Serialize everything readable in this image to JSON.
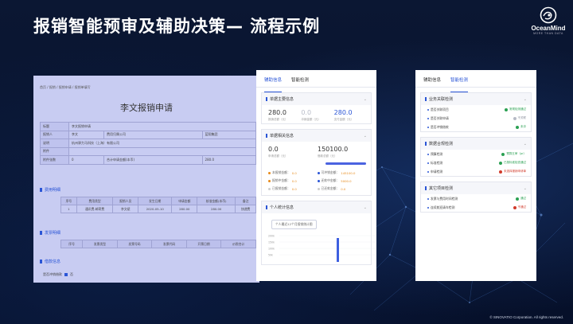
{
  "slide": {
    "title": "报销智能预审及辅助决策— 流程示例",
    "logo_name": "OceanMind",
    "logo_tagline": "MORE THAN DATA",
    "copyright": "© SINOVATIO Corporation. All rights reserved."
  },
  "form": {
    "breadcrumb": "首页  /  报销  /  报销申请  /  报销单填写",
    "title": "李文报销申请",
    "fields": [
      {
        "label": "标题",
        "value": "李文报销申请",
        "label2": "",
        "value2": ""
      },
      {
        "label": "报销人",
        "value": "李文",
        "label2": "费用归属公司",
        "value2": "蓝翔集团"
      },
      {
        "label": "说明",
        "value": "杭州驿力马科技（上海）有限公司",
        "label2": "",
        "value2": ""
      },
      {
        "label": "附件",
        "value": "",
        "label2": "",
        "value2": ""
      },
      {
        "label": "附件张数",
        "value": "0",
        "label2": "合计申请金额(本币)",
        "value2": "280.0"
      }
    ],
    "expense_section": "费用明细",
    "expense_headers": [
      "序号",
      "费用类型",
      "报销人员",
      "发生日期",
      "申请金额",
      "核准金额(本币)",
      "备注"
    ],
    "expense_rows": [
      [
        "1",
        "通讯费-邮寄费",
        "李文斌",
        "2020-05-10",
        "280.00",
        "280.00",
        "快递费"
      ]
    ],
    "invoice_section": "发票明细",
    "invoice_headers": [
      "序号",
      "发票类型",
      "发票号码",
      "发票代码",
      "开票日期",
      "价税合计"
    ],
    "loan_section": "借款信息",
    "loan_check_label": "是否冲销借款",
    "loan_check_value": "否"
  },
  "mid": {
    "tabs": [
      "辅助信息",
      "智能检测"
    ],
    "summary": {
      "title": "单据主要信息",
      "items": [
        {
          "value": "280.0",
          "label": "报销总额（元）"
        },
        {
          "value": "0.0",
          "label": "冲销金额（元）"
        },
        {
          "value": "280.0",
          "label": "支付金额（元）"
        }
      ]
    },
    "budget": {
      "title": "单据相关信息",
      "left": {
        "value": "0.0",
        "label": "申请总额（元）"
      },
      "right": {
        "value": "150100.0",
        "label": "借款总额（元）"
      },
      "stats": [
        {
          "label": "本报销金额：",
          "value": "0.0",
          "color": "#e88a1a"
        },
        {
          "label": "可冲销金额：",
          "value": "145100.0",
          "color": "#2a55d6"
        },
        {
          "label": "报销中金额：",
          "value": "0.0",
          "color": "#e88a1a"
        },
        {
          "label": "还款中金额：",
          "value": "5000.0",
          "color": "#2a55d6"
        },
        {
          "label": "已报销金额：",
          "value": "0.0",
          "color": "#cccccc"
        },
        {
          "label": "已还款金额：",
          "value": "0.0",
          "color": "#cccccc"
        }
      ]
    },
    "personal": {
      "title": "个人统计信息",
      "pill": "个人最近12个月报销统计图",
      "y_ticks": [
        "200k",
        "150k",
        "100k",
        "50k",
        "0"
      ]
    }
  },
  "right": {
    "tabs": [
      "辅助信息",
      "智能检测"
    ],
    "groups": [
      {
        "title": "业务关联检测",
        "rows": [
          {
            "label": "是否关联项目",
            "status": "常规检测通过",
            "kind": "ok"
          },
          {
            "label": "是否关联申请",
            "status": "不关联",
            "kind": "grey"
          },
          {
            "label": "是否冲销借款",
            "status": "未冲",
            "kind": "ok"
          }
        ]
      },
      {
        "title": "数据合规检测",
        "rows": [
          {
            "label": "预算检测",
            "status": "预算五审（pr）",
            "kind": "ok"
          },
          {
            "label": "标准检测",
            "status": "已按标准检查通过",
            "kind": "ok"
          },
          {
            "label": "申请检测",
            "status": "未选择报销申请单",
            "kind": "warn"
          }
        ]
      },
      {
        "title": "其它项目检测",
        "rows": [
          {
            "label": "发票与费用时间检测",
            "status": "通过",
            "kind": "ok"
          },
          {
            "label": "连续航班请车检测",
            "status": "不通过",
            "kind": "warn"
          }
        ]
      }
    ]
  },
  "colors": {
    "accent": "#2a55d6",
    "ok": "#2aa052",
    "warn": "#d13a2a",
    "slide_bg": "#07122b",
    "form_tint": "#c8ccf2"
  }
}
